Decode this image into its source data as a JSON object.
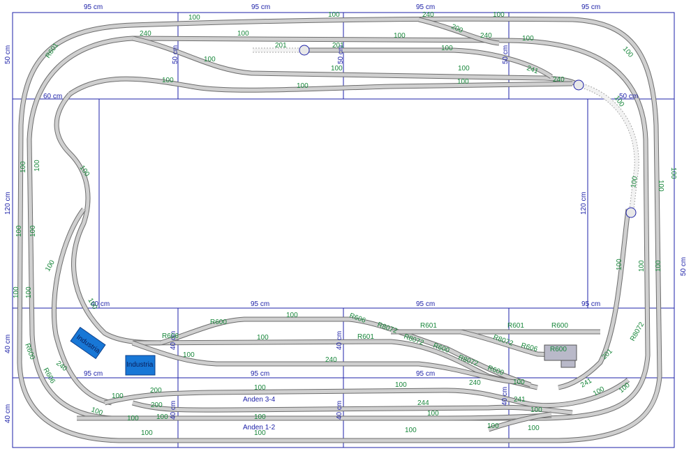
{
  "dimensions": {
    "top": [
      "95 cm",
      "95 cm",
      "95 cm",
      "95 cm"
    ],
    "left": [
      "50 cm",
      "120 cm",
      "40 cm",
      "40 cm"
    ],
    "inner": [
      "50 cm",
      "50 cm",
      "50 cm",
      "50 cm",
      "50 cm",
      "120 cm",
      "95 cm",
      "95 cm",
      "95 cm",
      "95 cm",
      "95 cm",
      "40 cm",
      "40 cm",
      "40 cm",
      "40 cm",
      "40 cm",
      "40 cm",
      "50 cm",
      "60 cm"
    ],
    "right": "50 cm"
  },
  "zones": {
    "platform_upper": "Anden 3-4",
    "platform_lower": "Anden 1-2"
  },
  "industries": [
    "Industria",
    "Industria"
  ],
  "track_labels": [
    "R601",
    "100",
    "240",
    "100",
    "100",
    "100",
    "100",
    "240",
    "100",
    "100",
    "200",
    "100",
    "240",
    "100",
    "201",
    "201",
    "100",
    "100",
    "100",
    "241",
    "240",
    "100",
    "100",
    "100",
    "100",
    "100",
    "100",
    "200",
    "100",
    "100",
    "100",
    "100",
    "100",
    "100",
    "100",
    "100",
    "100",
    "100",
    "100",
    "100",
    "100",
    "100",
    "100",
    "R606",
    "R8072",
    "R601",
    "R600",
    "R601",
    "R8072",
    "R600",
    "R606",
    "R600",
    "R601",
    "R8072",
    "R600",
    "R8072",
    "R606",
    "R600",
    "R8072",
    "100",
    "100",
    "100",
    "240",
    "240",
    "100",
    "240",
    "100",
    "100",
    "100",
    "200",
    "200",
    "244",
    "100",
    "100",
    "100",
    "100",
    "100",
    "241",
    "241",
    "201",
    "100",
    "100",
    "100",
    "100",
    "100",
    "100",
    "100",
    "100",
    "R8072",
    "R606",
    "R600",
    "R601",
    "R600"
  ],
  "colors": {
    "board": "#1e22a8",
    "track_bed": "#6d6d6d",
    "track_rail": "#cfcfcf",
    "label": "#17863a",
    "industry": "#1877d6"
  }
}
